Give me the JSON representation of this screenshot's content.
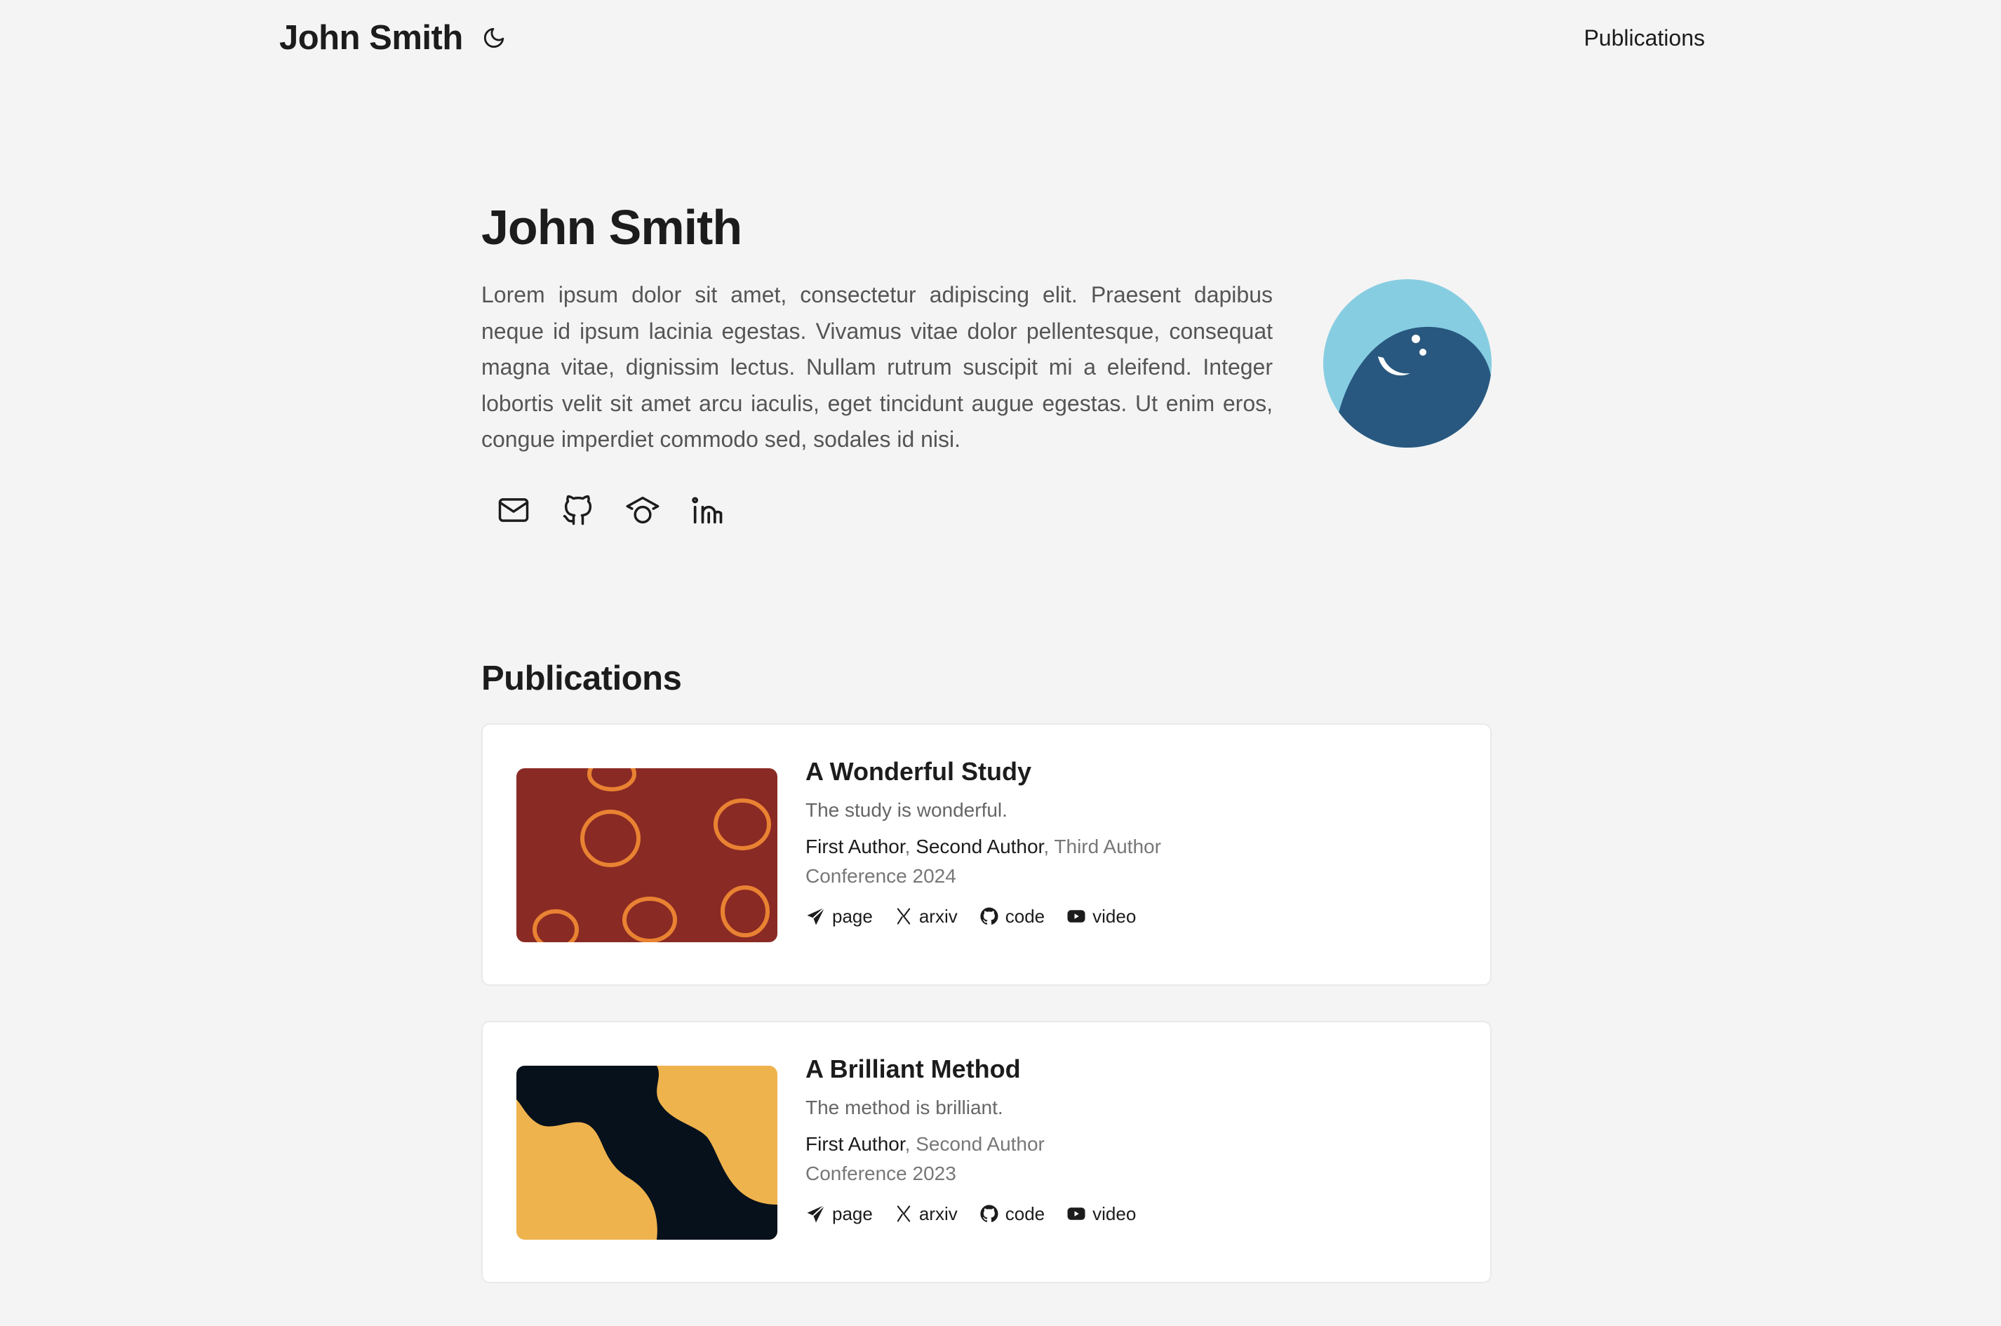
{
  "nav": {
    "brand": "John Smith",
    "theme_icon": "moon-icon",
    "links": [
      "Publications"
    ]
  },
  "hero": {
    "title": "John Smith",
    "bio": "Lorem ipsum dolor sit amet, consectetur adipiscing elit. Praesent dapibus neque id ipsum lacinia egestas. Vivamus vitae dolor pellentesque, consequat magna vitae, dignissim lectus. Nullam rutrum suscipit mi a eleifend. Integer lobortis velit sit amet arcu iaculis, eget tincidunt augue egestas. Ut enim eros, congue imperdiet commodo sed, sodales id nisi.",
    "social_icons": [
      "mail-icon",
      "github-icon",
      "graduation-cap-icon",
      "linkedin-icon"
    ],
    "avatar_colors": {
      "background": "#87cde2",
      "body": "#28587f"
    }
  },
  "publications": {
    "heading": "Publications",
    "items": [
      {
        "title": "A Wonderful Study",
        "description": "The study is wonderful.",
        "authors": [
          {
            "name": "First Author",
            "highlight": true
          },
          {
            "name": "Second Author",
            "highlight": true
          },
          {
            "name": "Third Author",
            "highlight": false
          }
        ],
        "venue": "Conference 2024",
        "links": [
          "page",
          "arxiv",
          "code",
          "video"
        ],
        "thumb_colors": {
          "background": "#8a2a24",
          "accent": "#e98232"
        }
      },
      {
        "title": "A Brilliant Method",
        "description": "The method is brilliant.",
        "authors": [
          {
            "name": "First Author",
            "highlight": true
          },
          {
            "name": "Second Author",
            "highlight": false
          }
        ],
        "venue": "Conference 2023",
        "links": [
          "page",
          "arxiv",
          "code",
          "video"
        ],
        "thumb_colors": {
          "background": "#efb34d",
          "accent": "#07111c"
        }
      }
    ]
  }
}
